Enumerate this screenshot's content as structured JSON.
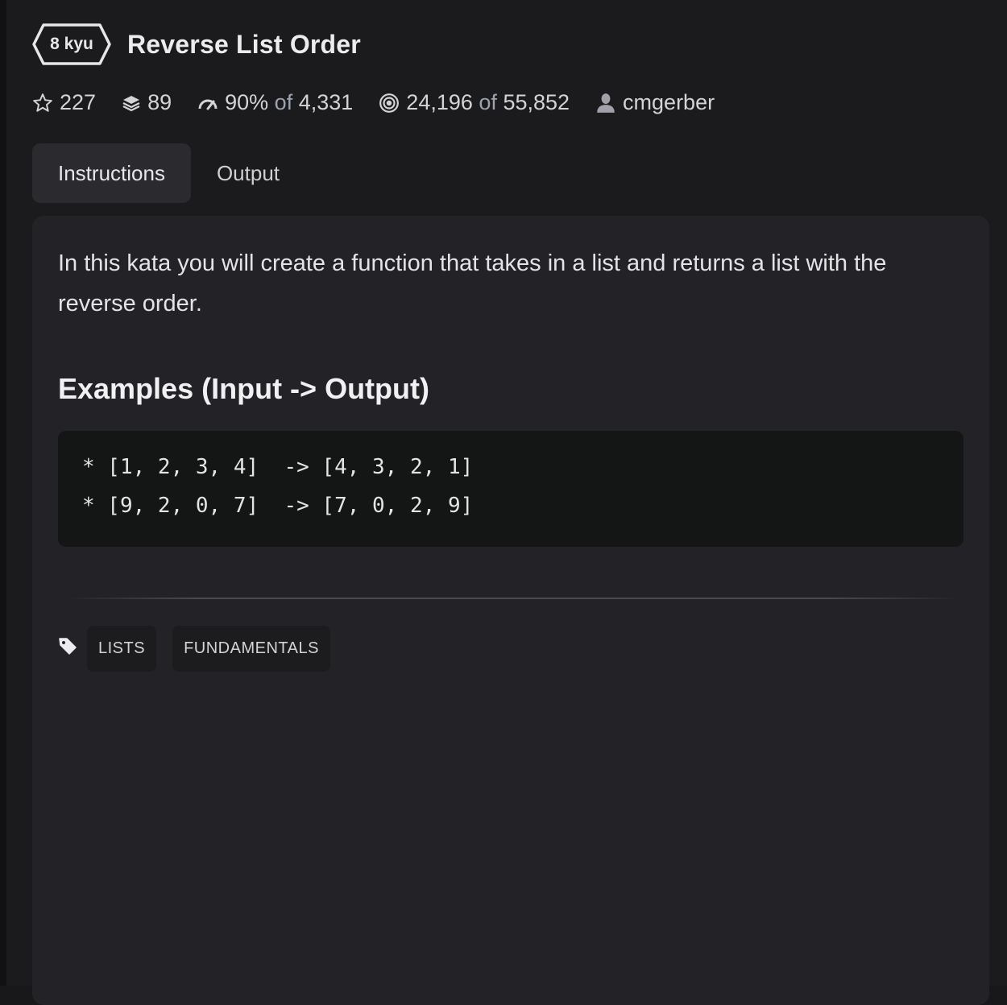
{
  "kata": {
    "rank": "8 kyu",
    "title": "Reverse List Order"
  },
  "stats": {
    "stars": "227",
    "collections": "89",
    "satisfaction_pct": "90%",
    "satisfaction_of": "of",
    "satisfaction_votes": "4,331",
    "completed": "24,196",
    "completed_of": "of",
    "attempted": "55,852",
    "author": "cmgerber"
  },
  "tabs": [
    {
      "label": "Instructions",
      "active": true
    },
    {
      "label": "Output",
      "active": false
    }
  ],
  "content": {
    "description": "In this kata you will create a function that takes in a list and returns a list with the reverse order.",
    "examples_heading": "Examples (Input -> Output)",
    "code_lines": [
      "* [1, 2, 3, 4]  -> [4, 3, 2, 1]",
      "* [9, 2, 0, 7]  -> [7, 0, 2, 9]"
    ]
  },
  "tags": [
    "LISTS",
    "FUNDAMENTALS"
  ],
  "icons": {
    "stars": "star-icon",
    "collections": "layers-icon",
    "satisfaction": "gauge-icon",
    "completed": "target-icon",
    "author": "user-icon",
    "tags": "tag-icon"
  },
  "colors": {
    "background": "#1b1b1e",
    "panel": "#232327",
    "code_background": "#141515",
    "active_tab": "#2a2a2f"
  }
}
